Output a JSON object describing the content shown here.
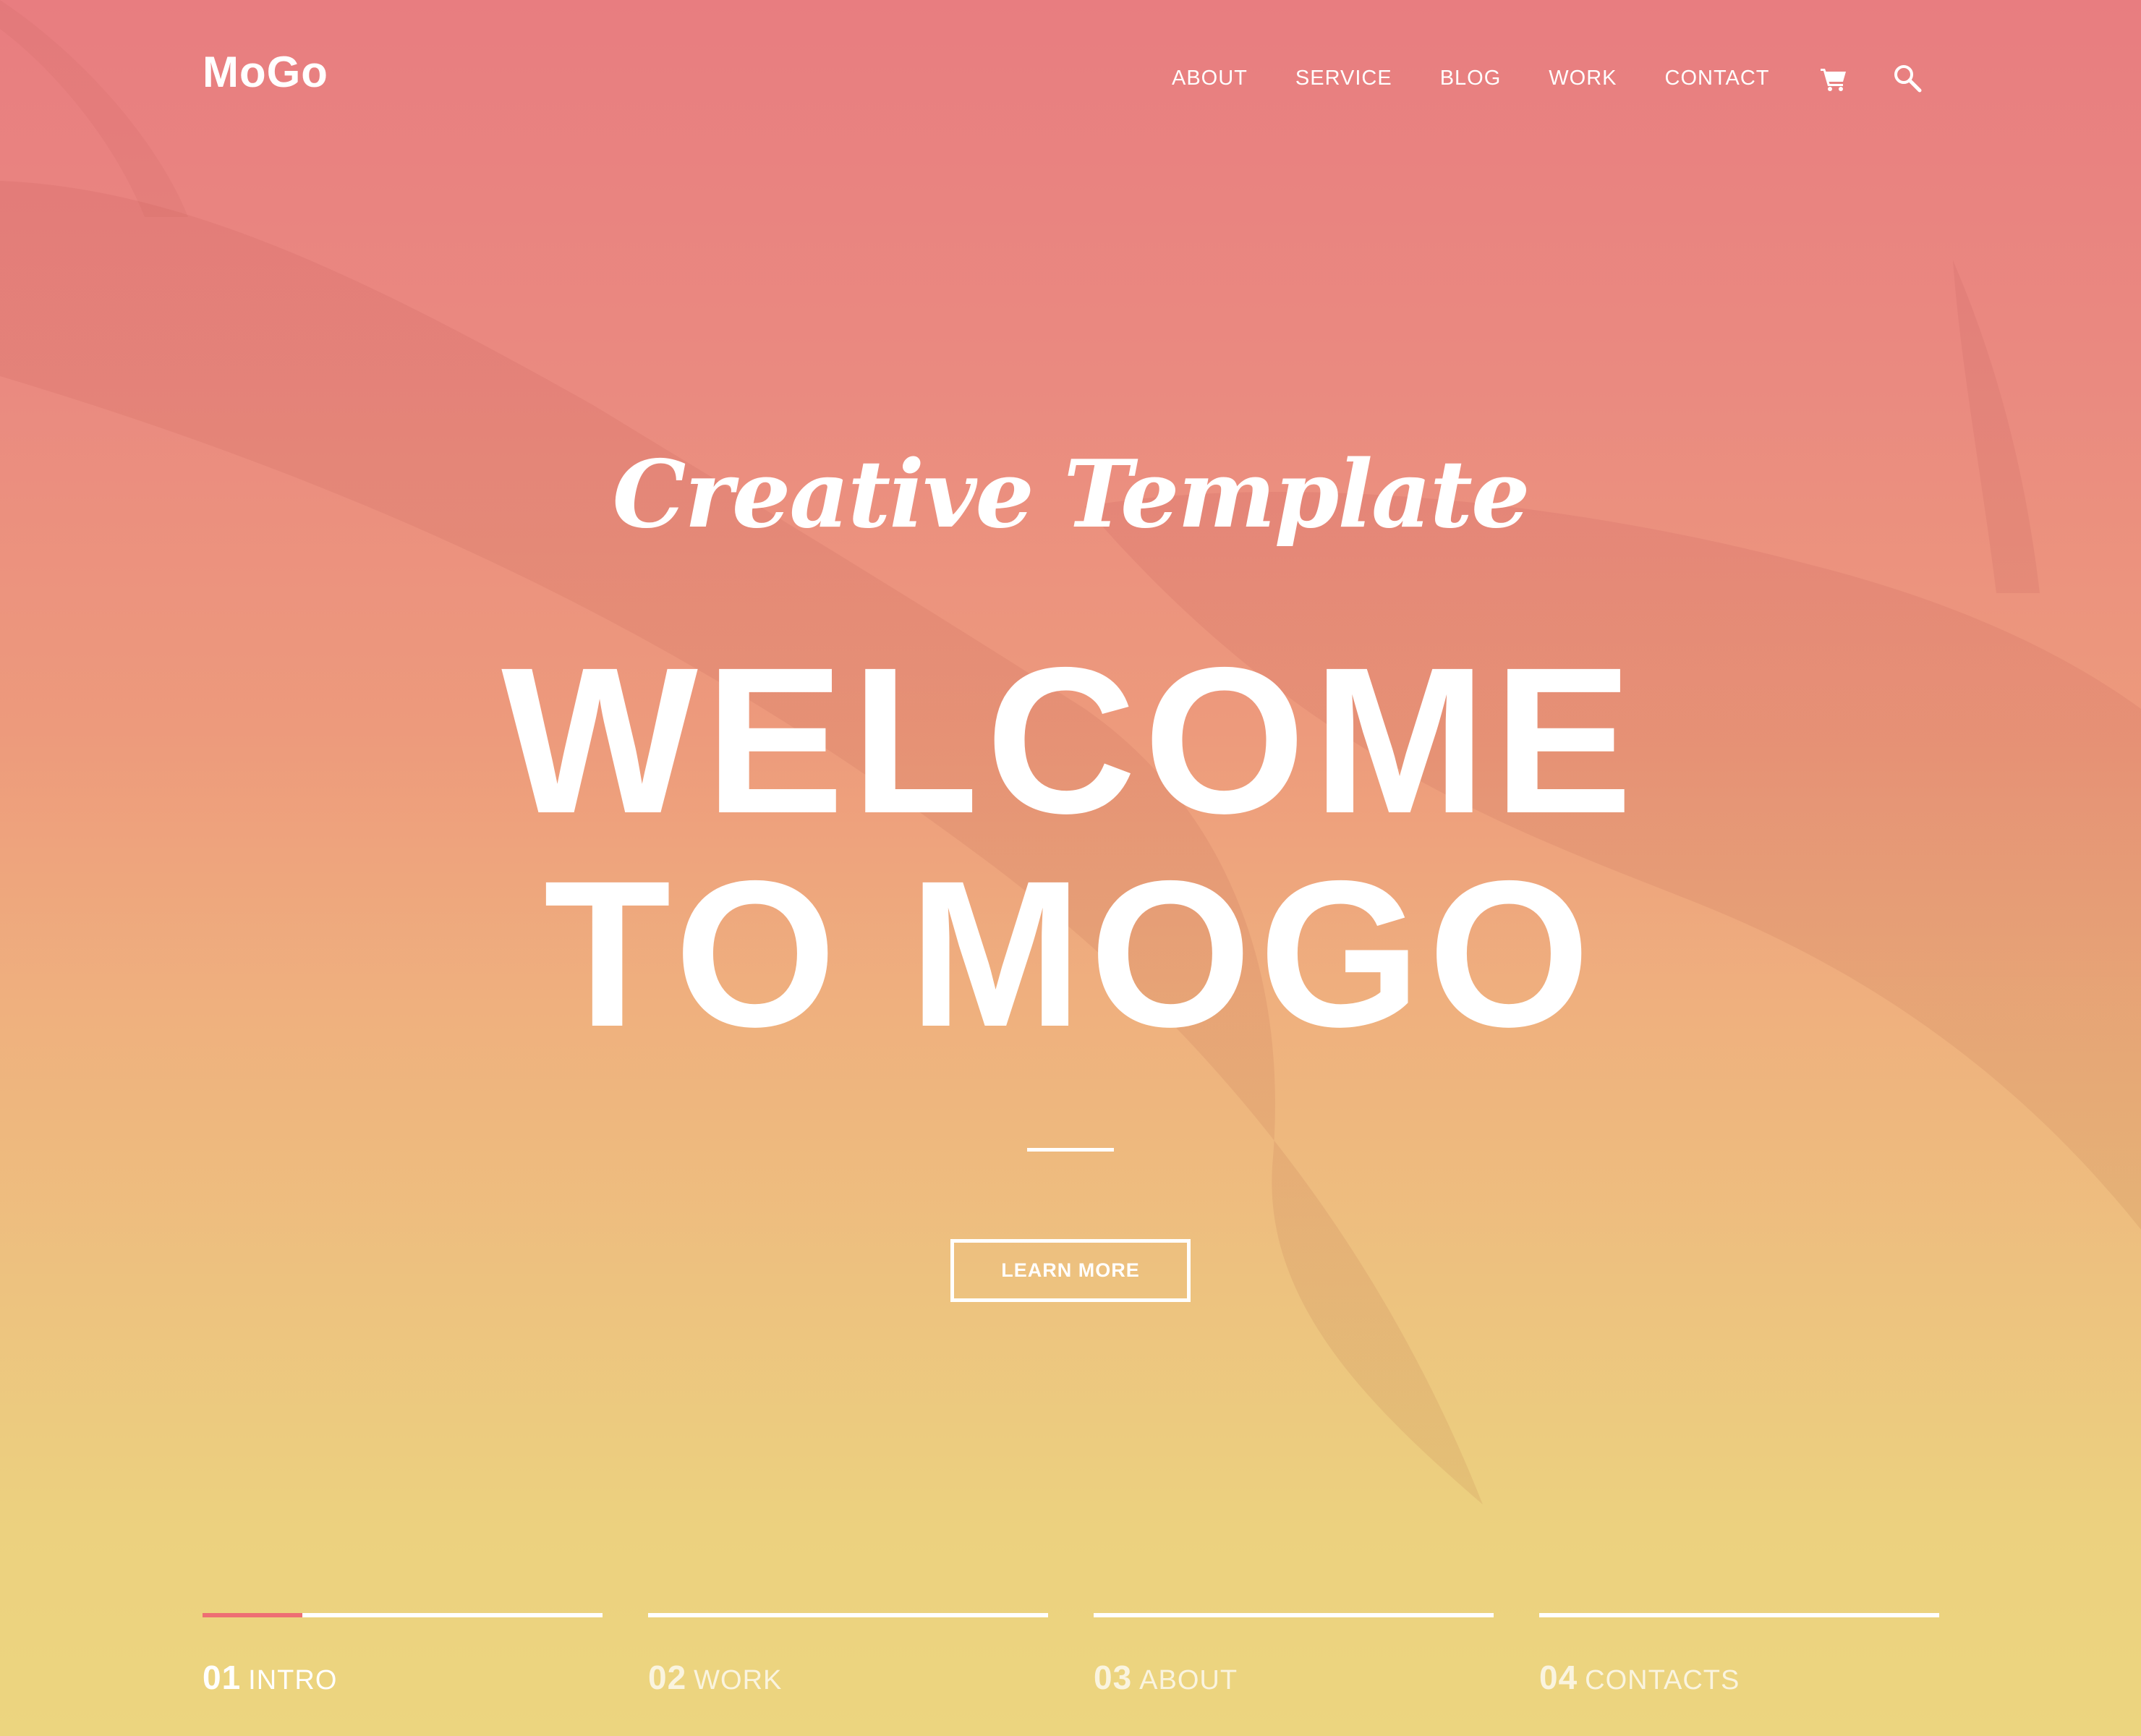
{
  "colors": {
    "text": "#ffffff",
    "accent": "#ee6e73",
    "gradient_top": "#e87d80",
    "gradient_bottom": "#ecd57f"
  },
  "header": {
    "logo": "MoGo",
    "nav": [
      {
        "label": "ABOUT"
      },
      {
        "label": "SERVICE"
      },
      {
        "label": "BLOG"
      },
      {
        "label": "WORK"
      },
      {
        "label": "CONTACT"
      }
    ],
    "icons": [
      "cart-icon",
      "search-icon"
    ]
  },
  "hero": {
    "subtitle": "Creative Template",
    "title_line1": "WELCOME",
    "title_line2": "TO MOGO",
    "button_label": "LEARN MORE"
  },
  "slider": {
    "tabs": [
      {
        "number": "01",
        "label": "INTRO",
        "active": true,
        "progress": 0.25
      },
      {
        "number": "02",
        "label": "WORK",
        "active": false,
        "progress": 0
      },
      {
        "number": "03",
        "label": "ABOUT",
        "active": false,
        "progress": 0
      },
      {
        "number": "04",
        "label": "CONTACTS",
        "active": false,
        "progress": 0
      }
    ]
  }
}
